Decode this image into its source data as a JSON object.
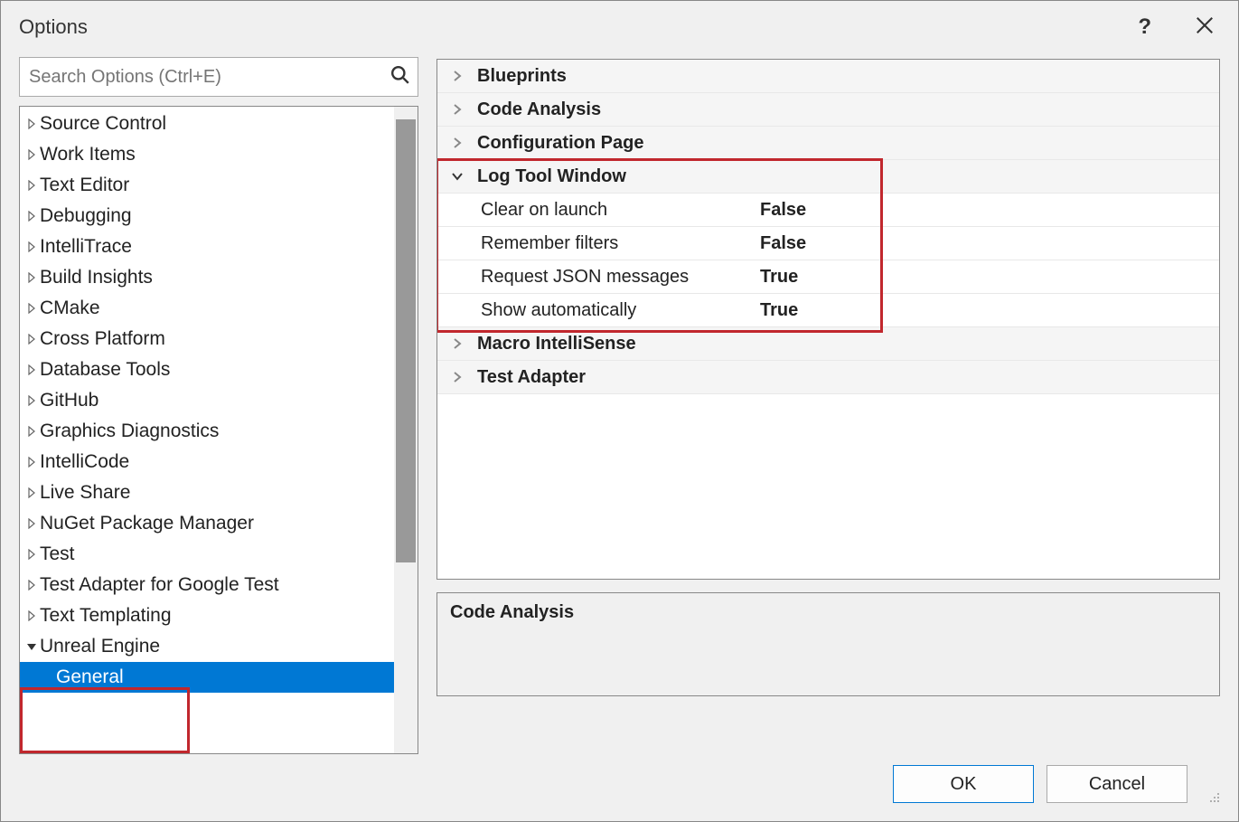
{
  "title": "Options",
  "search": {
    "placeholder": "Search Options (Ctrl+E)"
  },
  "tree": {
    "items": [
      {
        "label": "Source Control",
        "expanded": false
      },
      {
        "label": "Work Items",
        "expanded": false
      },
      {
        "label": "Text Editor",
        "expanded": false
      },
      {
        "label": "Debugging",
        "expanded": false
      },
      {
        "label": "IntelliTrace",
        "expanded": false
      },
      {
        "label": "Build Insights",
        "expanded": false
      },
      {
        "label": "CMake",
        "expanded": false
      },
      {
        "label": "Cross Platform",
        "expanded": false
      },
      {
        "label": "Database Tools",
        "expanded": false
      },
      {
        "label": "GitHub",
        "expanded": false
      },
      {
        "label": "Graphics Diagnostics",
        "expanded": false
      },
      {
        "label": "IntelliCode",
        "expanded": false
      },
      {
        "label": "Live Share",
        "expanded": false
      },
      {
        "label": "NuGet Package Manager",
        "expanded": false
      },
      {
        "label": "Test",
        "expanded": false
      },
      {
        "label": "Test Adapter for Google Test",
        "expanded": false
      },
      {
        "label": "Text Templating",
        "expanded": false
      },
      {
        "label": "Unreal Engine",
        "expanded": true,
        "children": [
          {
            "label": "General",
            "selected": true
          }
        ]
      }
    ]
  },
  "properties": {
    "categories": [
      {
        "label": "Blueprints",
        "expanded": false
      },
      {
        "label": "Code Analysis",
        "expanded": false
      },
      {
        "label": "Configuration Page",
        "expanded": false
      },
      {
        "label": "Log Tool Window",
        "expanded": true,
        "highlighted": true,
        "items": [
          {
            "label": "Clear on launch",
            "value": "False"
          },
          {
            "label": "Remember filters",
            "value": "False"
          },
          {
            "label": "Request JSON messages",
            "value": "True"
          },
          {
            "label": "Show automatically",
            "value": "True"
          }
        ]
      },
      {
        "label": "Macro IntelliSense",
        "expanded": false
      },
      {
        "label": "Test Adapter",
        "expanded": false
      }
    ]
  },
  "description": {
    "title": "Code Analysis"
  },
  "buttons": {
    "ok": "OK",
    "cancel": "Cancel"
  }
}
